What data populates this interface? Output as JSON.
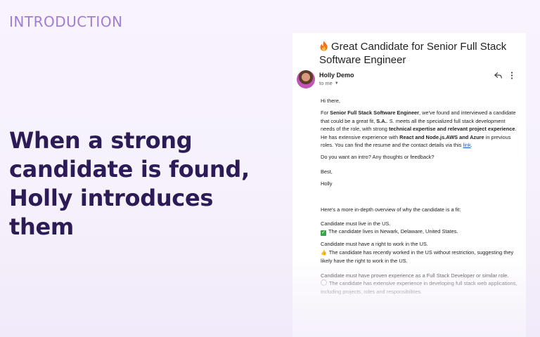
{
  "eyebrow": "INTRODUCTION",
  "headline": {
    "line1": "When a strong",
    "line2": "candidate is found,",
    "line3": "Holly introduces them"
  },
  "email": {
    "subject": "Great Candidate for Senior Full Stack Software Engineer",
    "subject_icon": "fire-emoji",
    "sender": "Holly Demo",
    "recipient": "to me",
    "greeting": "Hi there,",
    "p1": {
      "t1": "For ",
      "b1": "Senior Full Stack Software Engineer",
      "t2": ", we've found and interviewed a candidate that could be a great fit, ",
      "b2": "S.A.",
      "t3": ". S. meets all the specialized full stack development needs of the role, with strong ",
      "b3": "technical expertise and relevant project experience",
      "t4": ". He has extensive experience with ",
      "b4": "React and Node.js.AWS and Azure",
      "t5": " in previous roles. You can find the resume and the contact details via this ",
      "link": "link",
      "t6": "."
    },
    "question": "Do you want an intro? Any thoughts or feedback?",
    "signoff": "Best,",
    "signature": "Holly",
    "overview_intro": "Here's a more in-depth overview of why the candidate is a fit:",
    "criteria": [
      {
        "requirement": "Candidate must live in the US.",
        "icon": "check-mark-icon",
        "result": "The candidate lives in Newark, Delaware, United States."
      },
      {
        "requirement": "Candidate must have a right to work in the US.",
        "icon": "thumbs-up-icon",
        "result": "The candidate has recently worked in the US without restriction, suggesting they likely have the right to work in the US."
      },
      {
        "requirement": "Candidate must have proven experience as a Full Stack Developer or similar role.",
        "icon": "clock-icon",
        "result": "The candidate has extensive experience in developing full stack web applications, including projects, roles and responsibilities."
      }
    ]
  },
  "colors": {
    "eyebrow": "#a17ed1",
    "headline": "#2c1b56",
    "link": "#1a56c8",
    "check": "#3ca549"
  }
}
